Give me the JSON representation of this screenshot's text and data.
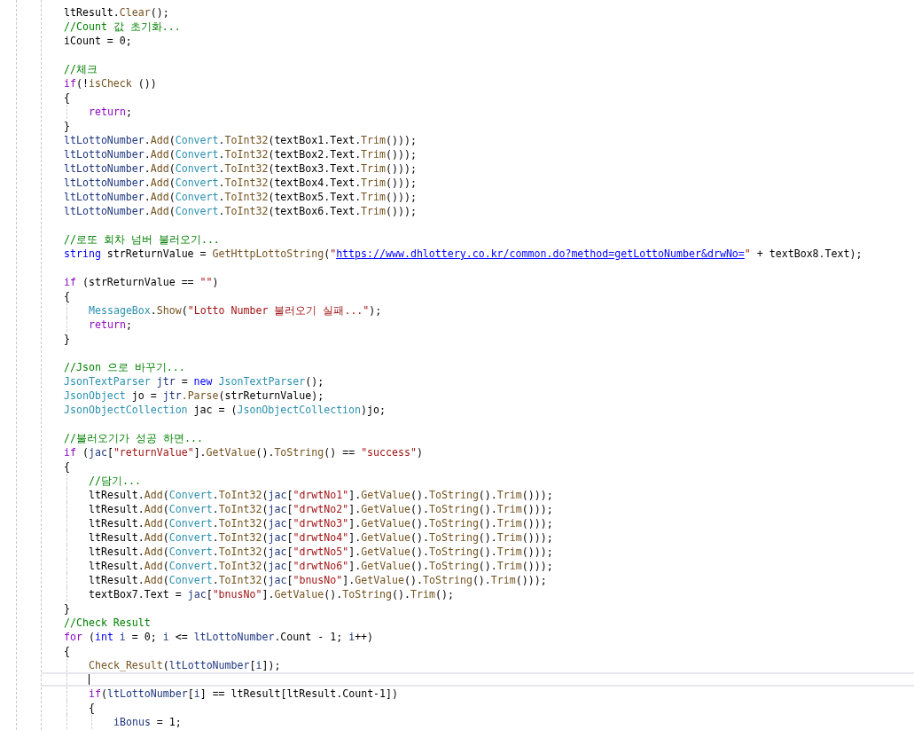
{
  "editor": {
    "lines": [
      {
        "kind": "code",
        "tokens": [
          {
            "kind": "plain",
            "text": "ltResult."
          },
          {
            "kind": "method",
            "text": "Clear"
          },
          {
            "kind": "plain",
            "text": "();"
          }
        ]
      },
      {
        "kind": "code",
        "tokens": [
          {
            "kind": "comment",
            "text": "//Count 값 초기화..."
          }
        ]
      },
      {
        "kind": "code",
        "tokens": [
          {
            "kind": "plain",
            "text": "iCount = 0;"
          }
        ]
      },
      {
        "kind": "blank"
      },
      {
        "kind": "code",
        "tokens": [
          {
            "kind": "comment",
            "text": "//체크"
          }
        ]
      },
      {
        "kind": "code",
        "tokens": [
          {
            "kind": "flow",
            "text": "if"
          },
          {
            "kind": "plain",
            "text": "(!"
          },
          {
            "kind": "method",
            "text": "isCheck"
          },
          {
            "kind": "plain",
            "text": " ())"
          }
        ]
      },
      {
        "kind": "code",
        "tokens": [
          {
            "kind": "plain",
            "text": "{"
          }
        ],
        "children": [
          {
            "kind": "code",
            "tokens": [
              {
                "kind": "flow",
                "text": "return"
              },
              {
                "kind": "plain",
                "text": ";"
              }
            ]
          }
        ]
      },
      {
        "kind": "code",
        "tokens": [
          {
            "kind": "plain",
            "text": "}"
          }
        ]
      },
      {
        "kind": "code",
        "tokens": [
          {
            "kind": "local",
            "text": "ltLottoNumber"
          },
          {
            "kind": "plain",
            "text": "."
          },
          {
            "kind": "method",
            "text": "Add"
          },
          {
            "kind": "plain",
            "text": "("
          },
          {
            "kind": "type",
            "text": "Convert"
          },
          {
            "kind": "plain",
            "text": "."
          },
          {
            "kind": "method",
            "text": "ToInt32"
          },
          {
            "kind": "plain",
            "text": "(textBox1.Text."
          },
          {
            "kind": "method",
            "text": "Trim"
          },
          {
            "kind": "plain",
            "text": "()));"
          }
        ]
      },
      {
        "kind": "code",
        "tokens": [
          {
            "kind": "local",
            "text": "ltLottoNumber"
          },
          {
            "kind": "plain",
            "text": "."
          },
          {
            "kind": "method",
            "text": "Add"
          },
          {
            "kind": "plain",
            "text": "("
          },
          {
            "kind": "type",
            "text": "Convert"
          },
          {
            "kind": "plain",
            "text": "."
          },
          {
            "kind": "method",
            "text": "ToInt32"
          },
          {
            "kind": "plain",
            "text": "(textBox2.Text."
          },
          {
            "kind": "method",
            "text": "Trim"
          },
          {
            "kind": "plain",
            "text": "()));"
          }
        ]
      },
      {
        "kind": "code",
        "tokens": [
          {
            "kind": "local",
            "text": "ltLottoNumber"
          },
          {
            "kind": "plain",
            "text": "."
          },
          {
            "kind": "method",
            "text": "Add"
          },
          {
            "kind": "plain",
            "text": "("
          },
          {
            "kind": "type",
            "text": "Convert"
          },
          {
            "kind": "plain",
            "text": "."
          },
          {
            "kind": "method",
            "text": "ToInt32"
          },
          {
            "kind": "plain",
            "text": "(textBox3.Text."
          },
          {
            "kind": "method",
            "text": "Trim"
          },
          {
            "kind": "plain",
            "text": "()));"
          }
        ]
      },
      {
        "kind": "code",
        "tokens": [
          {
            "kind": "local",
            "text": "ltLottoNumber"
          },
          {
            "kind": "plain",
            "text": "."
          },
          {
            "kind": "method",
            "text": "Add"
          },
          {
            "kind": "plain",
            "text": "("
          },
          {
            "kind": "type",
            "text": "Convert"
          },
          {
            "kind": "plain",
            "text": "."
          },
          {
            "kind": "method",
            "text": "ToInt32"
          },
          {
            "kind": "plain",
            "text": "(textBox4.Text."
          },
          {
            "kind": "method",
            "text": "Trim"
          },
          {
            "kind": "plain",
            "text": "()));"
          }
        ]
      },
      {
        "kind": "code",
        "tokens": [
          {
            "kind": "local",
            "text": "ltLottoNumber"
          },
          {
            "kind": "plain",
            "text": "."
          },
          {
            "kind": "method",
            "text": "Add"
          },
          {
            "kind": "plain",
            "text": "("
          },
          {
            "kind": "type",
            "text": "Convert"
          },
          {
            "kind": "plain",
            "text": "."
          },
          {
            "kind": "method",
            "text": "ToInt32"
          },
          {
            "kind": "plain",
            "text": "(textBox5.Text."
          },
          {
            "kind": "method",
            "text": "Trim"
          },
          {
            "kind": "plain",
            "text": "()));"
          }
        ]
      },
      {
        "kind": "code",
        "tokens": [
          {
            "kind": "local",
            "text": "ltLottoNumber"
          },
          {
            "kind": "plain",
            "text": "."
          },
          {
            "kind": "method",
            "text": "Add"
          },
          {
            "kind": "plain",
            "text": "("
          },
          {
            "kind": "type",
            "text": "Convert"
          },
          {
            "kind": "plain",
            "text": "."
          },
          {
            "kind": "method",
            "text": "ToInt32"
          },
          {
            "kind": "plain",
            "text": "(textBox6.Text."
          },
          {
            "kind": "method",
            "text": "Trim"
          },
          {
            "kind": "plain",
            "text": "()));"
          }
        ]
      },
      {
        "kind": "blank"
      },
      {
        "kind": "code",
        "tokens": [
          {
            "kind": "comment",
            "text": "//로또 회차 넘버 불러오기..."
          }
        ]
      },
      {
        "kind": "code",
        "tokens": [
          {
            "kind": "keyword",
            "text": "string"
          },
          {
            "kind": "plain",
            "text": " strReturnValue = "
          },
          {
            "kind": "method",
            "text": "GetHttpLottoString"
          },
          {
            "kind": "plain",
            "text": "("
          },
          {
            "kind": "string",
            "text": "\""
          },
          {
            "kind": "link",
            "text": "https://www.dhlottery.co.kr/common.do?method=getLottoNumber&drwNo="
          },
          {
            "kind": "string",
            "text": "\""
          },
          {
            "kind": "plain",
            "text": " + textBox8.Text);"
          }
        ]
      },
      {
        "kind": "blank"
      },
      {
        "kind": "code",
        "tokens": [
          {
            "kind": "flow",
            "text": "if"
          },
          {
            "kind": "plain",
            "text": " (strReturnValue == "
          },
          {
            "kind": "string",
            "text": "\"\""
          },
          {
            "kind": "plain",
            "text": ")"
          }
        ]
      },
      {
        "kind": "code",
        "tokens": [
          {
            "kind": "plain",
            "text": "{"
          }
        ],
        "children": [
          {
            "kind": "code",
            "tokens": [
              {
                "kind": "type",
                "text": "MessageBox"
              },
              {
                "kind": "plain",
                "text": "."
              },
              {
                "kind": "method",
                "text": "Show"
              },
              {
                "kind": "plain",
                "text": "("
              },
              {
                "kind": "string",
                "text": "\"Lotto Number 불러오기 실패...\""
              },
              {
                "kind": "plain",
                "text": ");"
              }
            ]
          },
          {
            "kind": "code",
            "tokens": [
              {
                "kind": "flow",
                "text": "return"
              },
              {
                "kind": "plain",
                "text": ";"
              }
            ]
          }
        ]
      },
      {
        "kind": "code",
        "tokens": [
          {
            "kind": "plain",
            "text": "}"
          }
        ]
      },
      {
        "kind": "blank"
      },
      {
        "kind": "code",
        "tokens": [
          {
            "kind": "comment",
            "text": "//Json 으로 바꾸기..."
          }
        ]
      },
      {
        "kind": "code",
        "tokens": [
          {
            "kind": "type",
            "text": "JsonTextParser"
          },
          {
            "kind": "local",
            "text": " jtr"
          },
          {
            "kind": "plain",
            "text": " = "
          },
          {
            "kind": "keyword",
            "text": "new"
          },
          {
            "kind": "type",
            "text": " JsonTextParser"
          },
          {
            "kind": "plain",
            "text": "();"
          }
        ]
      },
      {
        "kind": "code",
        "tokens": [
          {
            "kind": "type",
            "text": "JsonObject"
          },
          {
            "kind": "plain",
            "text": " jo = "
          },
          {
            "kind": "local",
            "text": "jtr"
          },
          {
            "kind": "method",
            "text": ".Parse"
          },
          {
            "kind": "plain",
            "text": "(strReturnValue);"
          }
        ]
      },
      {
        "kind": "code",
        "tokens": [
          {
            "kind": "type",
            "text": "JsonObjectCollection"
          },
          {
            "kind": "plain",
            "text": " jac = ("
          },
          {
            "kind": "type",
            "text": "JsonObjectCollection"
          },
          {
            "kind": "plain",
            "text": ")jo;"
          }
        ]
      },
      {
        "kind": "blank"
      },
      {
        "kind": "code",
        "tokens": [
          {
            "kind": "comment",
            "text": "//불러오기가 성공 하면..."
          }
        ]
      },
      {
        "kind": "code",
        "tokens": [
          {
            "kind": "flow",
            "text": "if"
          },
          {
            "kind": "plain",
            "text": " ("
          },
          {
            "kind": "local",
            "text": "jac"
          },
          {
            "kind": "plain",
            "text": "["
          },
          {
            "kind": "string",
            "text": "\"returnValue\""
          },
          {
            "kind": "plain",
            "text": "]."
          },
          {
            "kind": "method",
            "text": "GetValue"
          },
          {
            "kind": "plain",
            "text": "()."
          },
          {
            "kind": "method",
            "text": "ToString"
          },
          {
            "kind": "plain",
            "text": "() == "
          },
          {
            "kind": "string",
            "text": "\"success\""
          },
          {
            "kind": "plain",
            "text": ")"
          }
        ]
      },
      {
        "kind": "code",
        "tokens": [
          {
            "kind": "plain",
            "text": "{"
          }
        ],
        "children": [
          {
            "kind": "code",
            "tokens": [
              {
                "kind": "comment",
                "text": "//담기..."
              }
            ]
          },
          {
            "kind": "code",
            "tokens": [
              {
                "kind": "plain",
                "text": "ltResult."
              },
              {
                "kind": "method",
                "text": "Add"
              },
              {
                "kind": "plain",
                "text": "("
              },
              {
                "kind": "type",
                "text": "Convert"
              },
              {
                "kind": "plain",
                "text": "."
              },
              {
                "kind": "method",
                "text": "ToInt32"
              },
              {
                "kind": "plain",
                "text": "("
              },
              {
                "kind": "local",
                "text": "jac"
              },
              {
                "kind": "plain",
                "text": "["
              },
              {
                "kind": "string",
                "text": "\"drwtNo1\""
              },
              {
                "kind": "plain",
                "text": "]."
              },
              {
                "kind": "method",
                "text": "GetValue"
              },
              {
                "kind": "plain",
                "text": "()."
              },
              {
                "kind": "method",
                "text": "ToString"
              },
              {
                "kind": "plain",
                "text": "()."
              },
              {
                "kind": "method",
                "text": "Trim"
              },
              {
                "kind": "plain",
                "text": "()));"
              }
            ]
          },
          {
            "kind": "code",
            "tokens": [
              {
                "kind": "plain",
                "text": "ltResult."
              },
              {
                "kind": "method",
                "text": "Add"
              },
              {
                "kind": "plain",
                "text": "("
              },
              {
                "kind": "type",
                "text": "Convert"
              },
              {
                "kind": "plain",
                "text": "."
              },
              {
                "kind": "method",
                "text": "ToInt32"
              },
              {
                "kind": "plain",
                "text": "("
              },
              {
                "kind": "local",
                "text": "jac"
              },
              {
                "kind": "plain",
                "text": "["
              },
              {
                "kind": "string",
                "text": "\"drwtNo2\""
              },
              {
                "kind": "plain",
                "text": "]."
              },
              {
                "kind": "method",
                "text": "GetValue"
              },
              {
                "kind": "plain",
                "text": "()."
              },
              {
                "kind": "method",
                "text": "ToString"
              },
              {
                "kind": "plain",
                "text": "()."
              },
              {
                "kind": "method",
                "text": "Trim"
              },
              {
                "kind": "plain",
                "text": "()));"
              }
            ]
          },
          {
            "kind": "code",
            "tokens": [
              {
                "kind": "plain",
                "text": "ltResult."
              },
              {
                "kind": "method",
                "text": "Add"
              },
              {
                "kind": "plain",
                "text": "("
              },
              {
                "kind": "type",
                "text": "Convert"
              },
              {
                "kind": "plain",
                "text": "."
              },
              {
                "kind": "method",
                "text": "ToInt32"
              },
              {
                "kind": "plain",
                "text": "("
              },
              {
                "kind": "local",
                "text": "jac"
              },
              {
                "kind": "plain",
                "text": "["
              },
              {
                "kind": "string",
                "text": "\"drwtNo3\""
              },
              {
                "kind": "plain",
                "text": "]."
              },
              {
                "kind": "method",
                "text": "GetValue"
              },
              {
                "kind": "plain",
                "text": "()."
              },
              {
                "kind": "method",
                "text": "ToString"
              },
              {
                "kind": "plain",
                "text": "()."
              },
              {
                "kind": "method",
                "text": "Trim"
              },
              {
                "kind": "plain",
                "text": "()));"
              }
            ]
          },
          {
            "kind": "code",
            "tokens": [
              {
                "kind": "plain",
                "text": "ltResult."
              },
              {
                "kind": "method",
                "text": "Add"
              },
              {
                "kind": "plain",
                "text": "("
              },
              {
                "kind": "type",
                "text": "Convert"
              },
              {
                "kind": "plain",
                "text": "."
              },
              {
                "kind": "method",
                "text": "ToInt32"
              },
              {
                "kind": "plain",
                "text": "("
              },
              {
                "kind": "local",
                "text": "jac"
              },
              {
                "kind": "plain",
                "text": "["
              },
              {
                "kind": "string",
                "text": "\"drwtNo4\""
              },
              {
                "kind": "plain",
                "text": "]."
              },
              {
                "kind": "method",
                "text": "GetValue"
              },
              {
                "kind": "plain",
                "text": "()."
              },
              {
                "kind": "method",
                "text": "ToString"
              },
              {
                "kind": "plain",
                "text": "()."
              },
              {
                "kind": "method",
                "text": "Trim"
              },
              {
                "kind": "plain",
                "text": "()));"
              }
            ]
          },
          {
            "kind": "code",
            "tokens": [
              {
                "kind": "plain",
                "text": "ltResult."
              },
              {
                "kind": "method",
                "text": "Add"
              },
              {
                "kind": "plain",
                "text": "("
              },
              {
                "kind": "type",
                "text": "Convert"
              },
              {
                "kind": "plain",
                "text": "."
              },
              {
                "kind": "method",
                "text": "ToInt32"
              },
              {
                "kind": "plain",
                "text": "("
              },
              {
                "kind": "local",
                "text": "jac"
              },
              {
                "kind": "plain",
                "text": "["
              },
              {
                "kind": "string",
                "text": "\"drwtNo5\""
              },
              {
                "kind": "plain",
                "text": "]."
              },
              {
                "kind": "method",
                "text": "GetValue"
              },
              {
                "kind": "plain",
                "text": "()."
              },
              {
                "kind": "method",
                "text": "ToString"
              },
              {
                "kind": "plain",
                "text": "()."
              },
              {
                "kind": "method",
                "text": "Trim"
              },
              {
                "kind": "plain",
                "text": "()));"
              }
            ]
          },
          {
            "kind": "code",
            "tokens": [
              {
                "kind": "plain",
                "text": "ltResult."
              },
              {
                "kind": "method",
                "text": "Add"
              },
              {
                "kind": "plain",
                "text": "("
              },
              {
                "kind": "type",
                "text": "Convert"
              },
              {
                "kind": "plain",
                "text": "."
              },
              {
                "kind": "method",
                "text": "ToInt32"
              },
              {
                "kind": "plain",
                "text": "("
              },
              {
                "kind": "local",
                "text": "jac"
              },
              {
                "kind": "plain",
                "text": "["
              },
              {
                "kind": "string",
                "text": "\"drwtNo6\""
              },
              {
                "kind": "plain",
                "text": "]."
              },
              {
                "kind": "method",
                "text": "GetValue"
              },
              {
                "kind": "plain",
                "text": "()."
              },
              {
                "kind": "method",
                "text": "ToString"
              },
              {
                "kind": "plain",
                "text": "()."
              },
              {
                "kind": "method",
                "text": "Trim"
              },
              {
                "kind": "plain",
                "text": "()));"
              }
            ]
          },
          {
            "kind": "code",
            "tokens": [
              {
                "kind": "plain",
                "text": "ltResult."
              },
              {
                "kind": "method",
                "text": "Add"
              },
              {
                "kind": "plain",
                "text": "("
              },
              {
                "kind": "type",
                "text": "Convert"
              },
              {
                "kind": "plain",
                "text": "."
              },
              {
                "kind": "method",
                "text": "ToInt32"
              },
              {
                "kind": "plain",
                "text": "("
              },
              {
                "kind": "local",
                "text": "jac"
              },
              {
                "kind": "plain",
                "text": "["
              },
              {
                "kind": "string",
                "text": "\"bnusNo\""
              },
              {
                "kind": "plain",
                "text": "]."
              },
              {
                "kind": "method",
                "text": "GetValue"
              },
              {
                "kind": "plain",
                "text": "()."
              },
              {
                "kind": "method",
                "text": "ToString"
              },
              {
                "kind": "plain",
                "text": "()."
              },
              {
                "kind": "method",
                "text": "Trim"
              },
              {
                "kind": "plain",
                "text": "()));"
              }
            ]
          },
          {
            "kind": "code",
            "tokens": [
              {
                "kind": "plain",
                "text": "textBox7.Text = "
              },
              {
                "kind": "local",
                "text": "jac"
              },
              {
                "kind": "plain",
                "text": "["
              },
              {
                "kind": "string",
                "text": "\"bnusNo\""
              },
              {
                "kind": "plain",
                "text": "]."
              },
              {
                "kind": "method",
                "text": "GetValue"
              },
              {
                "kind": "plain",
                "text": "()."
              },
              {
                "kind": "method",
                "text": "ToString"
              },
              {
                "kind": "plain",
                "text": "()."
              },
              {
                "kind": "method",
                "text": "Trim"
              },
              {
                "kind": "plain",
                "text": "();"
              }
            ]
          }
        ]
      },
      {
        "kind": "code",
        "tokens": [
          {
            "kind": "plain",
            "text": "}"
          }
        ]
      },
      {
        "kind": "code",
        "tokens": [
          {
            "kind": "comment",
            "text": "//Check Result"
          }
        ]
      },
      {
        "kind": "code",
        "tokens": [
          {
            "kind": "flow",
            "text": "for"
          },
          {
            "kind": "plain",
            "text": " ("
          },
          {
            "kind": "keyword",
            "text": "int"
          },
          {
            "kind": "local",
            "text": " i"
          },
          {
            "kind": "plain",
            "text": " = 0; "
          },
          {
            "kind": "local",
            "text": "i"
          },
          {
            "kind": "plain",
            "text": " <= "
          },
          {
            "kind": "local",
            "text": "ltLottoNumber"
          },
          {
            "kind": "plain",
            "text": ".Count - 1; "
          },
          {
            "kind": "local",
            "text": "i"
          },
          {
            "kind": "plain",
            "text": "++)"
          }
        ]
      },
      {
        "kind": "code",
        "tokens": [
          {
            "kind": "plain",
            "text": "{"
          }
        ],
        "children": [
          {
            "kind": "code",
            "tokens": [
              {
                "kind": "method",
                "text": "Check_Result"
              },
              {
                "kind": "plain",
                "text": "("
              },
              {
                "kind": "local",
                "text": "ltLottoNumber"
              },
              {
                "kind": "plain",
                "text": "["
              },
              {
                "kind": "local",
                "text": "i"
              },
              {
                "kind": "plain",
                "text": "]);"
              }
            ]
          },
          {
            "kind": "cursor"
          },
          {
            "kind": "code",
            "tokens": [
              {
                "kind": "flow",
                "text": "if"
              },
              {
                "kind": "plain",
                "text": "("
              },
              {
                "kind": "local",
                "text": "ltLottoNumber"
              },
              {
                "kind": "plain",
                "text": "["
              },
              {
                "kind": "local",
                "text": "i"
              },
              {
                "kind": "plain",
                "text": "] == ltResult[ltResult.Count-1])"
              }
            ]
          },
          {
            "kind": "code",
            "tokens": [
              {
                "kind": "plain",
                "text": "{"
              }
            ],
            "children": [
              {
                "kind": "code",
                "tokens": [
                  {
                    "kind": "local",
                    "text": "iBonus"
                  },
                  {
                    "kind": "plain",
                    "text": " = 1;"
                  }
                ]
              }
            ]
          }
        ]
      }
    ]
  }
}
